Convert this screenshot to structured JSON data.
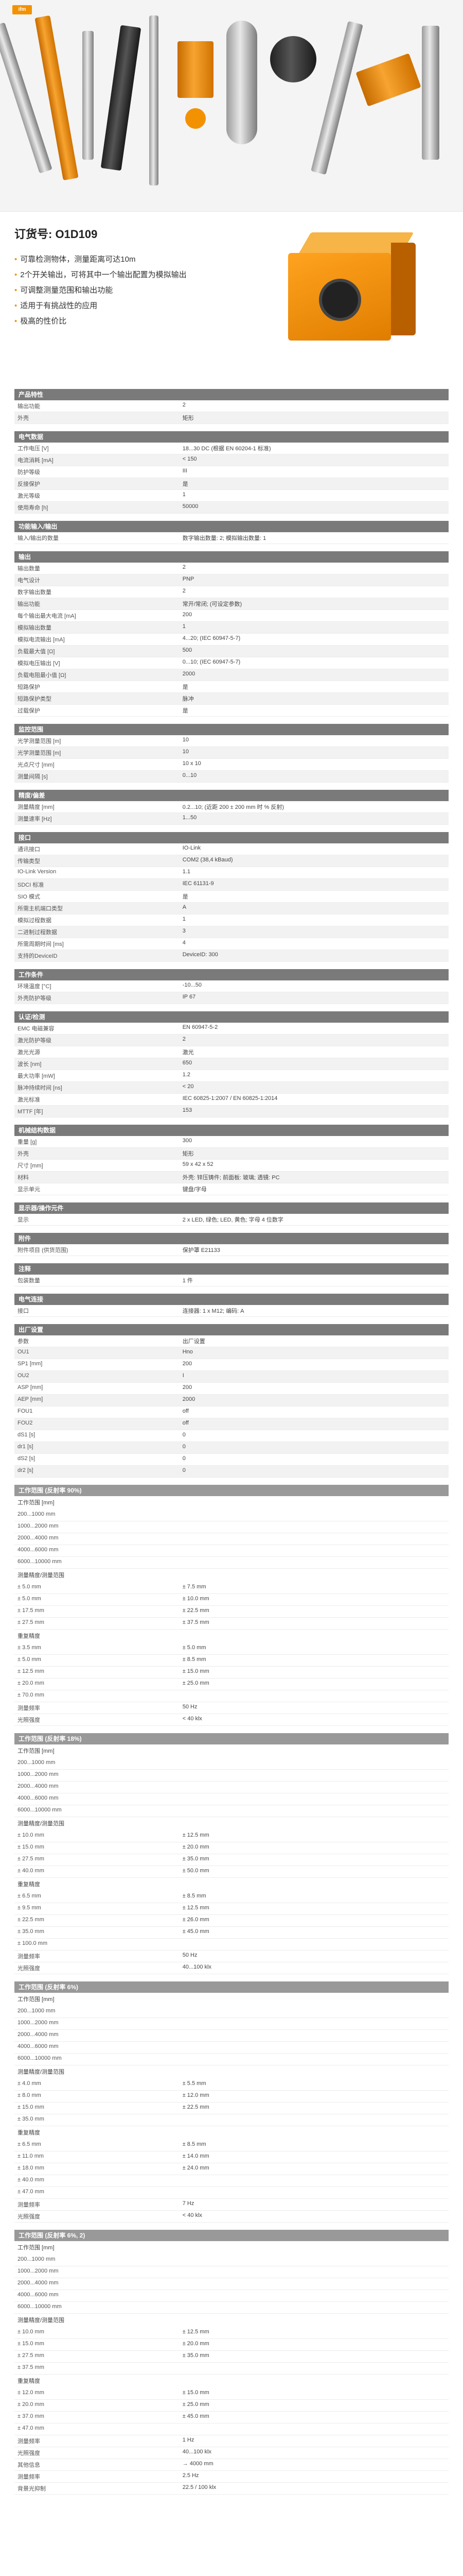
{
  "brand": {
    "logo": "ifm"
  },
  "hero": {
    "order_label": "订货号: O1D109",
    "features": [
      "可靠检测物体，测量距离可达10m",
      "2个开关输出，可将其中一个输出配置为模拟输出",
      "可调整测量范围和输出功能",
      "适用于有挑战性的应用",
      "极高的性价比"
    ]
  },
  "sections": [
    {
      "title": "产品特性",
      "rows": [
        [
          "输出功能",
          "2"
        ],
        [
          "外壳",
          "矩形"
        ]
      ]
    },
    {
      "title": "电气数据",
      "rows": [
        [
          "工作电压 [V]",
          "18...30 DC (根据 EN 60204-1 标准)"
        ],
        [
          "电流消耗 [mA]",
          "< 150"
        ],
        [
          "防护等级",
          "III"
        ],
        [
          "反接保护",
          "是"
        ],
        [
          "激光等级",
          "1"
        ],
        [
          "使用寿命 [h]",
          "50000"
        ]
      ]
    },
    {
      "title": "功能输入/输出",
      "rows": [
        [
          "输入/输出的数量",
          "数字输出数量: 2; 模拟输出数量: 1"
        ]
      ]
    },
    {
      "title": "输出",
      "rows": [
        [
          "输出数量",
          "2"
        ],
        [
          "电气设计",
          "PNP"
        ],
        [
          "数字输出数量",
          "2"
        ],
        [
          "输出功能",
          "常开/常闭; (可设定参数)"
        ],
        [
          "每个输出最大电流 [mA]",
          "200"
        ],
        [
          "模拟输出数量",
          "1"
        ],
        [
          "模拟电流输出 [mA]",
          "4...20; (IEC 60947-5-7)"
        ],
        [
          "负载最大值 [Ω]",
          "500"
        ],
        [
          "模拟电压输出 [V]",
          "0...10; (IEC 60947-5-7)"
        ],
        [
          "负载电阻最小值 [Ω]",
          "2000"
        ],
        [
          "短路保护",
          "是"
        ],
        [
          "短路保护类型",
          "脉冲"
        ],
        [
          "过载保护",
          "是"
        ]
      ]
    },
    {
      "title": "监控范围",
      "rows": [
        [
          "光学测量范围 [m]",
          "10"
        ],
        [
          "光学测量范围 [m]",
          "10"
        ],
        [
          "光点尺寸 [mm]",
          "10 x 10"
        ],
        [
          "测量间隔 [s]",
          "0...10"
        ]
      ]
    },
    {
      "title": "精度/偏差",
      "rows": [
        [
          "测量精度 [mm]",
          "0.2...10; (近距 200 ± 200 mm 时 % 反射)"
        ],
        [
          "测量速率 [Hz]",
          "1...50"
        ]
      ]
    },
    {
      "title": "接口",
      "rows": [
        [
          "通讯接口",
          "IO-Link"
        ],
        [
          "传输类型",
          "COM2 (38,4 kBaud)"
        ],
        [
          "IO-Link Version",
          "1.1"
        ],
        [
          "SDCI 标准",
          "IEC 61131-9"
        ],
        [
          "SIO 模式",
          "是"
        ],
        [
          "所需主机端口类型",
          "A"
        ],
        [
          "模拟过程数据",
          "1"
        ],
        [
          "二进制过程数据",
          "3"
        ],
        [
          "所需周期时间 [ms]",
          "4"
        ],
        [
          "支持的DeviceID",
          "DeviceID: 300"
        ]
      ]
    },
    {
      "title": "工作条件",
      "rows": [
        [
          "环境温度 [°C]",
          "-10...50"
        ],
        [
          "外壳防护等级",
          "IP 67"
        ]
      ]
    },
    {
      "title": "认证/检测",
      "rows": [
        [
          "EMC 电磁兼容",
          "EN 60947-5-2"
        ],
        [
          "激光防护等级",
          "2"
        ],
        [
          "激光光源",
          "激光"
        ],
        [
          "波长 [nm]",
          "650"
        ],
        [
          "最大功率 [mW]",
          "1.2"
        ],
        [
          "脉冲持续时间 [ns]",
          "< 20"
        ],
        [
          "激光标准",
          "IEC 60825-1:2007 / EN 60825-1:2014"
        ],
        [
          "MTTF [年]",
          "153"
        ]
      ]
    },
    {
      "title": "机械结构数据",
      "rows": [
        [
          "重量 [g]",
          "300"
        ],
        [
          "外壳",
          "矩形"
        ],
        [
          "尺寸 [mm]",
          "59 x 42 x 52"
        ],
        [
          "材料",
          "外壳: 锌压铸件; 前面板: 玻璃; 透镜: PC"
        ],
        [
          "显示单元",
          "键盘/字母"
        ]
      ]
    },
    {
      "title": "显示器/操作元件",
      "rows": [
        [
          "显示",
          "2 x LED, 绿色; LED, 黄色; 字母 4 位数字"
        ]
      ]
    },
    {
      "title": "附件",
      "rows": [
        [
          "附件项目 (供货范围)",
          "保护罩 E21133"
        ]
      ]
    },
    {
      "title": "注释",
      "rows": [
        [
          "包装数量",
          "1 件"
        ]
      ]
    },
    {
      "title": "电气连接",
      "rows": [
        [
          "接口",
          "连接器: 1 x M12; 编码: A"
        ]
      ]
    },
    {
      "title": "出厂设置",
      "rows": [
        [
          "参数",
          "出厂设置"
        ],
        [
          "OU1",
          "Hno"
        ],
        [
          "SP1 [mm]",
          "200"
        ],
        [
          "OU2",
          "I"
        ],
        [
          "ASP [mm]",
          "200"
        ],
        [
          "AEP [mm]",
          "2000"
        ],
        [
          "FOU1",
          "off"
        ],
        [
          "FOU2",
          "off"
        ],
        [
          "dS1 [s]",
          "0"
        ],
        [
          "dr1 [s]",
          "0"
        ],
        [
          "dS2 [s]",
          "0"
        ],
        [
          "dr2 [s]",
          "0"
        ]
      ]
    }
  ],
  "range_blocks": [
    {
      "title": "工作范围 (反射率 90%)",
      "header": "工作范围 [mm]",
      "ranges": [
        "200...1000 mm",
        "1000...2000 mm",
        "2000...4000 mm",
        "4000...6000 mm",
        "6000...10000 mm"
      ],
      "sub1": "测量精度/测量范围",
      "sub1_rows": [
        [
          "± 5.0 mm",
          "± 7.5 mm"
        ],
        [
          "± 5.0 mm",
          "± 10.0 mm"
        ],
        [
          "± 17.5 mm",
          "± 22.5 mm"
        ],
        [
          "± 27.5 mm",
          "± 37.5 mm"
        ]
      ],
      "sub2": "重复精度",
      "sub2_rows": [
        [
          "± 3.5 mm",
          "± 5.0 mm"
        ],
        [
          "± 5.0 mm",
          "± 8.5 mm"
        ],
        [
          "± 12.5 mm",
          "± 15.0 mm"
        ],
        [
          "± 20.0 mm",
          "± 25.0 mm"
        ],
        [
          "± 70.0 mm",
          ""
        ]
      ],
      "tail": [
        [
          "测量频率",
          "50 Hz"
        ],
        [
          "光照强度",
          "< 40 klx"
        ]
      ]
    },
    {
      "title": "工作范围 (反射率 18%)",
      "header": "工作范围 [mm]",
      "ranges": [
        "200...1000 mm",
        "1000...2000 mm",
        "2000...4000 mm",
        "4000...6000 mm",
        "6000...10000 mm"
      ],
      "sub1": "测量精度/测量范围",
      "sub1_rows": [
        [
          "± 10.0 mm",
          "± 12.5 mm"
        ],
        [
          "± 15.0 mm",
          "± 20.0 mm"
        ],
        [
          "± 27.5 mm",
          "± 35.0 mm"
        ],
        [
          "± 40.0 mm",
          "± 50.0 mm"
        ]
      ],
      "sub2": "重复精度",
      "sub2_rows": [
        [
          "± 6.5 mm",
          "± 8.5 mm"
        ],
        [
          "± 9.5 mm",
          "± 12.5 mm"
        ],
        [
          "± 22.5 mm",
          "± 26.0 mm"
        ],
        [
          "± 35.0 mm",
          "± 45.0 mm"
        ],
        [
          "± 100.0 mm",
          ""
        ]
      ],
      "tail": [
        [
          "测量频率",
          "50 Hz"
        ],
        [
          "光照强度",
          "40...100 klx"
        ]
      ]
    },
    {
      "title": "工作范围 (反射率 6%)",
      "header": "工作范围 [mm]",
      "ranges": [
        "200...1000 mm",
        "1000...2000 mm",
        "2000...4000 mm",
        "4000...6000 mm",
        "6000...10000 mm"
      ],
      "sub1": "测量精度/测量范围",
      "sub1_rows": [
        [
          "± 4.0 mm",
          "± 5.5 mm"
        ],
        [
          "± 8.0 mm",
          "± 12.0 mm"
        ],
        [
          "± 15.0 mm",
          "± 22.5 mm"
        ],
        [
          "± 35.0 mm",
          ""
        ]
      ],
      "sub2": "重复精度",
      "sub2_rows": [
        [
          "± 6.5 mm",
          "± 8.5 mm"
        ],
        [
          "± 11.0 mm",
          "± 14.0 mm"
        ],
        [
          "± 18.0 mm",
          "± 24.0 mm"
        ],
        [
          "± 40.0 mm",
          ""
        ],
        [
          "± 47.0 mm",
          ""
        ]
      ],
      "tail": [
        [
          "测量频率",
          "7 Hz"
        ],
        [
          "光照强度",
          "< 40 klx"
        ]
      ]
    },
    {
      "title": "工作范围 (反射率 6%, 2)",
      "header": "工作范围 [mm]",
      "ranges": [
        "200...1000 mm",
        "1000...2000 mm",
        "2000...4000 mm",
        "4000...6000 mm",
        "6000...10000 mm"
      ],
      "sub1": "测量精度/测量范围",
      "sub1_rows": [
        [
          "± 10.0 mm",
          "± 12.5 mm"
        ],
        [
          "± 15.0 mm",
          "± 20.0 mm"
        ],
        [
          "± 27.5 mm",
          "± 35.0 mm"
        ],
        [
          "± 37.5 mm",
          ""
        ]
      ],
      "sub2": "重复精度",
      "sub2_rows": [
        [
          "± 12.0 mm",
          "± 15.0 mm"
        ],
        [
          "± 20.0 mm",
          "± 25.0 mm"
        ],
        [
          "± 37.0 mm",
          "± 45.0 mm"
        ],
        [
          "± 47.0 mm",
          ""
        ]
      ],
      "tail": [
        [
          "测量频率",
          "1 Hz"
        ],
        [
          "光照强度",
          "40...100 klx"
        ],
        [
          "其他信息",
          "→ 4000 mm"
        ],
        [
          "测量频率",
          "2.5 Hz"
        ],
        [
          "背景光抑制",
          "22.5 / 100 klx"
        ]
      ]
    }
  ]
}
